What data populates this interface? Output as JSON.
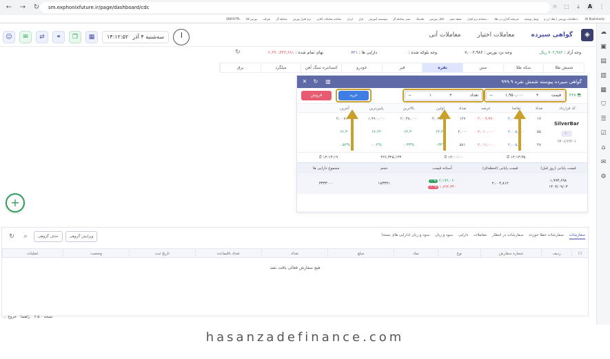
{
  "browser": {
    "url": "sm.exphonixfuture.ir/page/dashboard/cdc",
    "bookmarks": [
      "All Bookmarks",
      "اطلاعات بورسی | طلا، ارز و...",
      "وبینار توسعه",
      "سرمایه گذاری در طلا",
      "سامانه نرم افزار...",
      "نقطه صفر",
      "کانال بورسی",
      "هلدینگ",
      "مینی معامله گر",
      "موسسه آموزش",
      "بازار",
      "ایران",
      "سامانه معاملات آنلاین",
      "نرم افزار بورس",
      "معامله گر",
      "شرکت",
      "بورس کالا",
      "EN/FA/TPL"
    ]
  },
  "header": {
    "tabs": [
      "گواهی سپرده",
      "معاملات اختیار",
      "معاملات آتی"
    ],
    "active_tab": "گواهی سپرده",
    "date": "سه‌شنبه ۴ آذر",
    "time": "۱۴:۱۲:۵۲"
  },
  "account": {
    "cash_label": "وجه آزاد :",
    "cash_value": "۷۰۲,۹۸۲ ریال",
    "broker_label": "وجه نزد بورس :",
    "broker_value": "۷,۰۰۲,۹۸۶",
    "blocked_label": "وجه بلوکه شده :",
    "blocked_value": "۰",
    "assets_label": "دارایی ها :",
    "assets_value": "۷۲۱",
    "total_label": "بهای تمام شده :",
    "total_value": "۶,۶۹۰,۳۲۳,۶۸۱"
  },
  "commodities": [
    "شمش طلا",
    "سکه طلا",
    "مس",
    "نقره",
    "قیر",
    "خودرو",
    "کنسانتره سنگ آهن",
    "میلگرد",
    "برق"
  ],
  "active_commodity": "نقره",
  "panel": {
    "title": "گواهی سپرده پیوسته شمش نقره ۹۹۹.۹",
    "symbol_badge": "۳۶۷",
    "price_label": "قیمت",
    "price_value": "۱,۹۵۰,۰۰۰",
    "qty_label": "تعداد",
    "qty_value": "۱",
    "buy_label": "خرید",
    "sell_label": "فروش",
    "depth_headers": [
      "کد قرارداد",
      "تعداد",
      "تقاضا",
      "عرضه",
      "تعداد",
      "اولین",
      "بالاترین",
      "پایین‌ترین",
      "آخرین"
    ],
    "symbol": "SilverBar",
    "symbol_tag": "۱۰",
    "symbol_date": "۱۴۰۱/۱۲/۰۱",
    "depth_rows": [
      {
        "cnt": "۱۷",
        "bid": "۲,۰۰۴,۳۰۰",
        "ask": "۲,۰۰۹,۹۹۰",
        "scnt": "۱۲۷",
        "first": "۲,۰۲۸,۰۰۰",
        "max": "۲,۰۳۸,۰۰۰",
        "min": "۱,۹۹۰,۰۰۰",
        "last": "۲,۰۰۷,۰۰۰"
      },
      {
        "cnt": "۵۵",
        "bid": "۲,۰۰۵,۰۰۰",
        "ask": "۲,۰۱۰,۰۰۰",
        "scnt": "۲,۰۰۰",
        "first": "۶۲,۳۰",
        "max": "۶۲,۳۰",
        "min": "۶۶,۲۲",
        "last": "۶۶,۳۰"
      },
      {
        "cnt": "۴۸",
        "bid": "۲,۰۰۵,۵۰۰",
        "ask": "۲,۰۱۱,۰۰۰",
        "scnt": "۵۸۱",
        "first": "۰.۳۴%",
        "max": "۰.۳۳%",
        "min": "۰.۰۲%",
        "last": "۰.۵۲%"
      }
    ],
    "stats": [
      "۱۴:۱۳:۳۵",
      "۱۲:۰۰:۰۰",
      "۴۲۶,۳۲۵,۱۴۳",
      "۱۴:۱۳:۱۹"
    ],
    "summary_headers": [
      "قیمت پایانی (روز قبل)",
      "قیمت پایانی (لحظه‌ای)",
      "آستانه قیمت",
      "حجم",
      "مجموع دارایی ها"
    ],
    "summary": {
      "prev_close": "۱,۹۹۳,۶۹۸",
      "prev_close_date": "۱۴۰۴/۰۹/۰۳",
      "live_close": "۲,۰۰۴,۸۱۲",
      "upper": "۲,۱۹۲,۰۶۰",
      "upper_pct": "۱۰%",
      "lower": "۱,۷۹۴,۳۳۰",
      "lower_pct": "-۱۰%",
      "volume": "۱۸۳۳۴۱",
      "total_assets": "۳۳۳۳۰۰۰"
    }
  },
  "orders": {
    "tabs": [
      "سفارشات",
      "سفارشات خطا خورده",
      "سفارشات در انتظار",
      "معاملات",
      "دارایی",
      "سود و زیان",
      "سود و زیان (دارایی های بسته)"
    ],
    "active_tab": "سفارشات",
    "edit_group": "ویرایش گروهی",
    "delete_group": "حذف گروهی",
    "columns": [
      "",
      "ردیف",
      "شماره سفارش",
      "نوع",
      "نماد",
      "مبلغ",
      "تعداد",
      "تعداد باقیمانده",
      "تاریخ ثبت",
      "وضعیت",
      "عملیات"
    ],
    "empty": "هیچ سفارش فعالی یافت نشد"
  },
  "footer": {
    "version": "نسخه ۶.۵.۰",
    "help": "راهنما",
    "exit": "خروج"
  },
  "watermark": "hasanzadefinance.com",
  "colors": {
    "accent": "#4a4fa3",
    "highlight": "#c9a029",
    "buy": "#3f7de4",
    "sell": "#e85a70",
    "positive": "#2e9d5b",
    "negative": "#e0565b"
  }
}
